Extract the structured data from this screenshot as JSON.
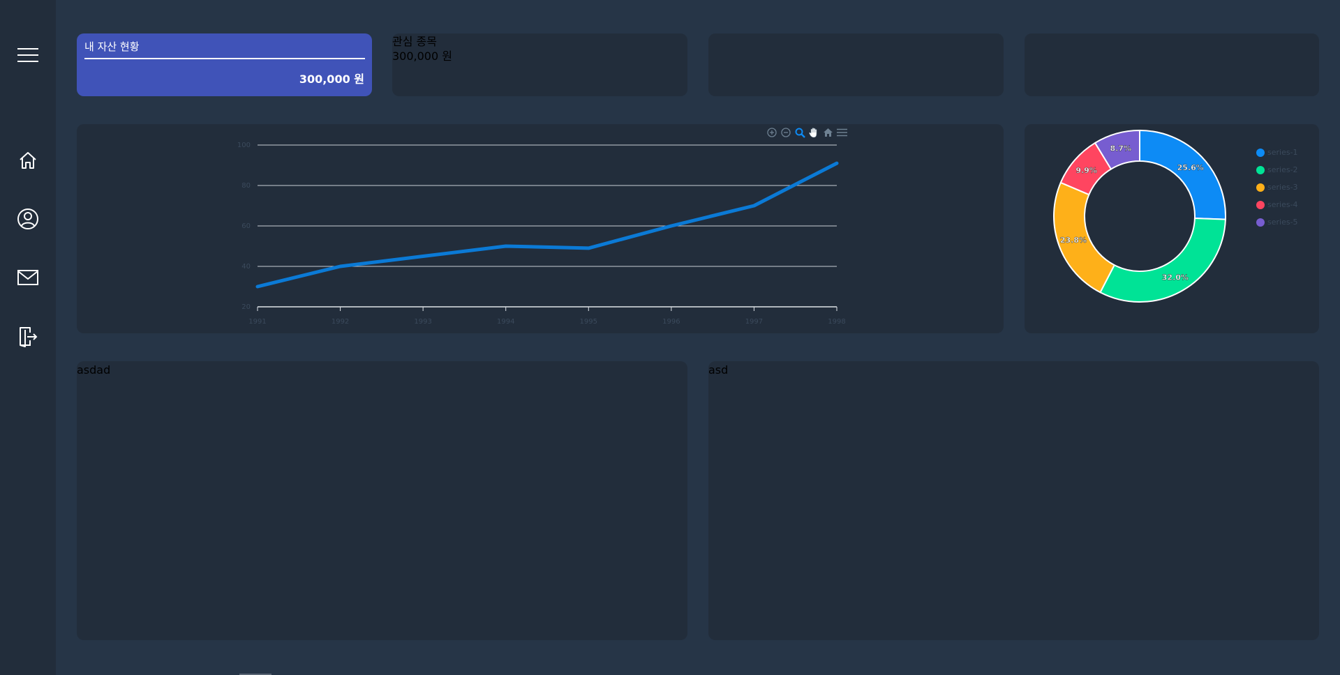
{
  "sidebar": {
    "items": [
      {
        "name": "menu",
        "icon": "hamburger-menu-icon"
      },
      {
        "name": "home",
        "icon": "home-icon"
      },
      {
        "name": "profile",
        "icon": "user-circle-icon"
      },
      {
        "name": "mail",
        "icon": "mail-icon"
      },
      {
        "name": "logout",
        "icon": "logout-icon"
      }
    ]
  },
  "summary_cards": {
    "asset": {
      "title": "내 자산 현황",
      "value": "300,000 원",
      "color": "#4053b8"
    },
    "watchlist": {
      "title": "관심 종목",
      "value": "300,000 원"
    }
  },
  "panels": {
    "left_label": "asdad",
    "right_label": "asd"
  },
  "toolbar": {
    "icons": [
      "zoom-in-icon",
      "zoom-out-icon",
      "selection-zoom-icon",
      "pan-icon",
      "reset-home-icon",
      "menu-icon"
    ],
    "active": "selection-zoom-icon"
  },
  "chart_data": [
    {
      "type": "line",
      "x": [
        "1991",
        "1992",
        "1993",
        "1994",
        "1995",
        "1996",
        "1997",
        "1998"
      ],
      "series": [
        {
          "values": [
            30,
            40,
            45,
            50,
            49,
            60,
            70,
            91
          ],
          "color": "#0b7ad6"
        }
      ],
      "y_ticks": [
        "20",
        "40",
        "60",
        "80",
        "100"
      ],
      "ylim": [
        20,
        100
      ],
      "grid": true
    },
    {
      "type": "pie",
      "donut": true,
      "series": [
        {
          "name": "series-1",
          "value": 25.6,
          "label": "25.6%",
          "color": "#0d8bf5"
        },
        {
          "name": "series-2",
          "value": 32.0,
          "label": "32.0%",
          "color": "#00e396"
        },
        {
          "name": "series-3",
          "value": 23.8,
          "label": "23.8%",
          "color": "#feb019"
        },
        {
          "name": "series-4",
          "value": 9.9,
          "label": "9.9%",
          "color": "#ff4560"
        },
        {
          "name": "series-5",
          "value": 8.7,
          "label": "8.7%",
          "color": "#775dd0"
        }
      ],
      "legend": "right"
    }
  ]
}
